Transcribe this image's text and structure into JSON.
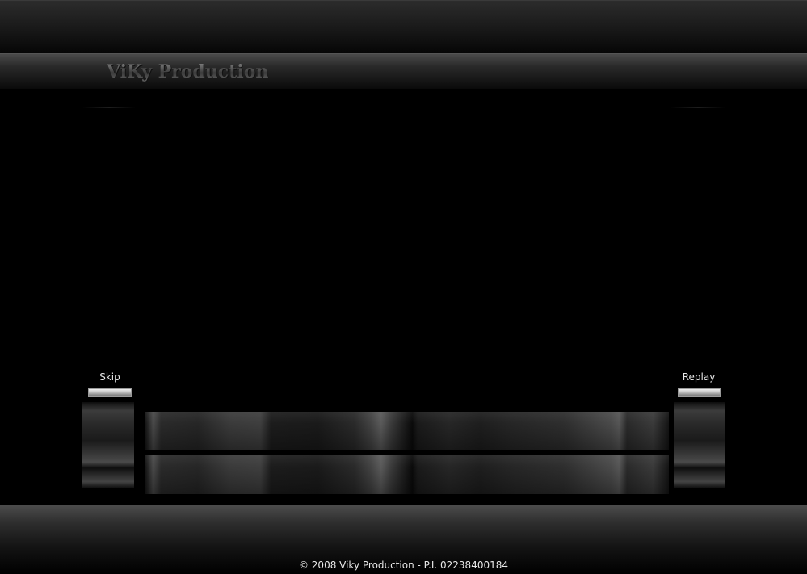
{
  "header": {
    "logo_text": "ViKy Production"
  },
  "controls": {
    "skip_label": "Skip",
    "replay_label": "Replay"
  },
  "footer": {
    "copyright": "© 2008 Viky Production - P.I. 02238400184"
  },
  "colors": {
    "background": "#000000",
    "band": "#2c2c2c",
    "label": "#e6e6e6",
    "button_highlight": "#f0f0f0"
  }
}
